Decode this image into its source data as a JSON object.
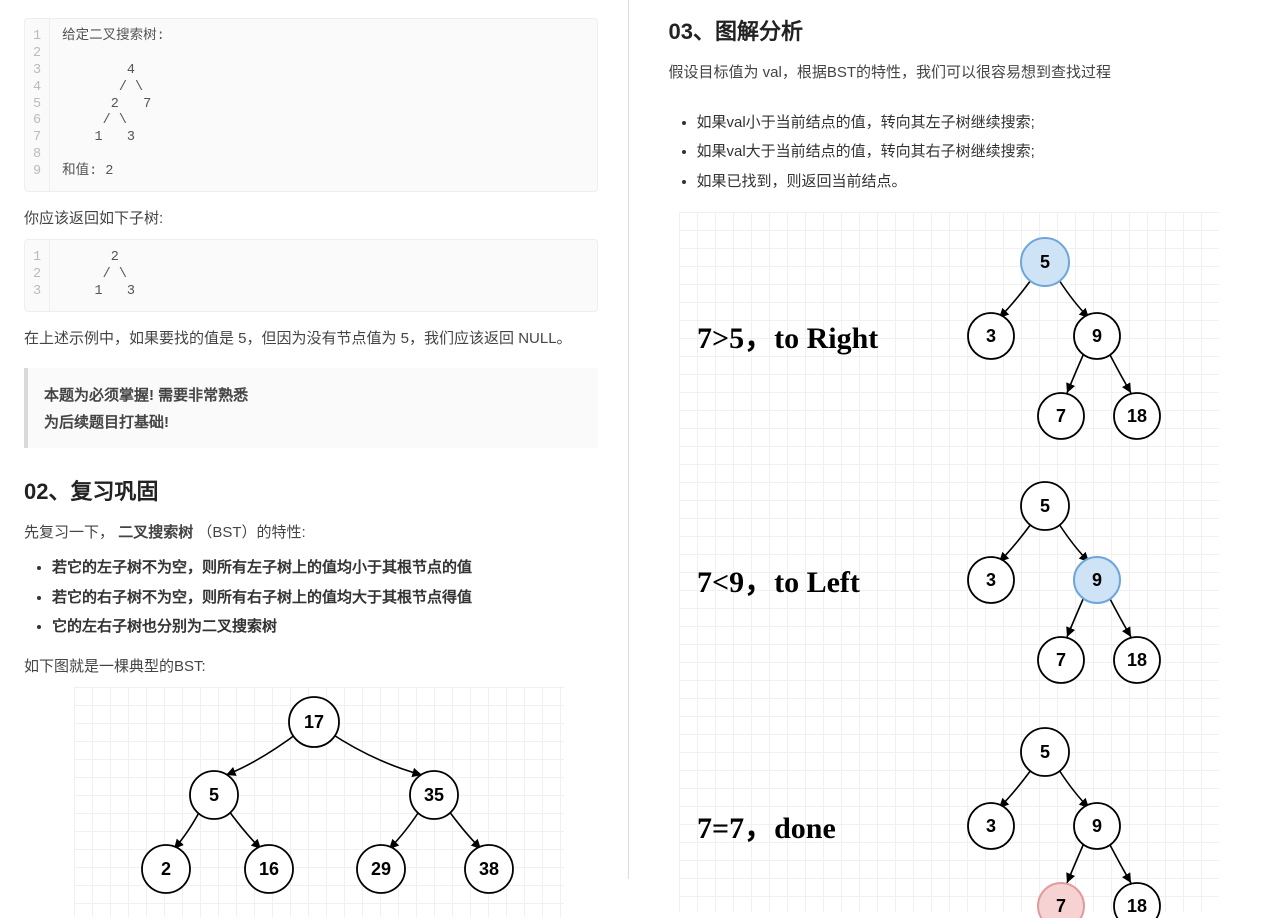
{
  "left": {
    "code1_lines": "1\n2\n3\n4\n5\n6\n7\n8\n9",
    "code1": "给定二叉搜索树:\n\n        4\n       / \\\n      2   7\n     / \\\n    1   3\n\n和值: 2",
    "return_text": "你应该返回如下子树:",
    "code2_lines": "1\n2\n3",
    "code2": "      2\n     / \\\n    1   3",
    "example_text": "在上述示例中，如果要找的值是 5，但因为没有节点值为 5，我们应该返回 NULL。",
    "quote_line1": "本题为必须掌握! 需要非常熟悉",
    "quote_line2": "为后续题目打基础!",
    "h_02": "02、复习巩固",
    "review_prefix": "先复习一下，",
    "review_bold": "二叉搜索树",
    "review_suffix": "（BST）的特性:",
    "bst_b1": "若它的左子树不为空，则所有左子树上的值均小于其根节点的值",
    "bst_b2": "若它的右子树不为空，则所有右子树上的值均大于其根节点得值",
    "bst_b3": "它的左右子树也分别为二叉搜索树",
    "typical_text": "如下图就是一棵典型的BST:",
    "tree_left": {
      "n17": "17",
      "n5": "5",
      "n35": "35",
      "n2": "2",
      "n16": "16",
      "n29": "29",
      "n38": "38"
    }
  },
  "right": {
    "h_03": "03、图解分析",
    "intro": "假设目标值为 val，根据BST的特性，我们可以很容易想到查找过程",
    "r_b1": "如果val小于当前结点的值，转向其左子树继续搜索;",
    "r_b2": "如果val大于当前结点的值，转向其右子树继续搜索;",
    "r_b3": "如果已找到，则返回当前结点。",
    "cap1": "7>5，to Right",
    "cap2": "7<9，to Left",
    "cap3": "7=7，done",
    "nodes": {
      "n5": "5",
      "n3": "3",
      "n9": "9",
      "n7": "7",
      "n18": "18"
    }
  }
}
